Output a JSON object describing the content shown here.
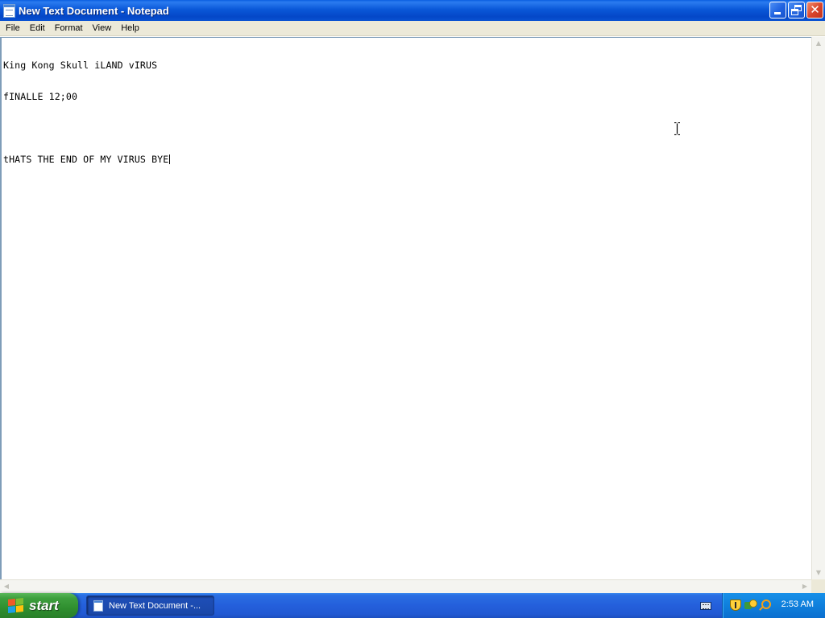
{
  "window": {
    "title": "New Text Document - Notepad",
    "app_icon": "notepad-icon",
    "controls": {
      "minimize_icon": "minimize-icon",
      "restore_icon": "restore-icon",
      "close_icon": "close-icon",
      "close_glyph": "✕"
    }
  },
  "menu": {
    "items": [
      {
        "label": "File"
      },
      {
        "label": "Edit"
      },
      {
        "label": "Format"
      },
      {
        "label": "View"
      },
      {
        "label": "Help"
      }
    ]
  },
  "editor": {
    "lines": [
      "King Kong Skull iLAND vIRUS",
      "fINALLE 12;00",
      "",
      "tHATS THE END OF MY VIRUS BYE"
    ]
  },
  "scrollbars": {
    "up_arrow": "▲",
    "down_arrow": "▼",
    "left_arrow": "◀",
    "right_arrow": "▶"
  },
  "taskbar": {
    "start_label": "start",
    "task_button_label": "New Text Document -...",
    "clock": "2:53 AM",
    "tray_icons": [
      "keyboard-icon",
      "security-shield-icon",
      "network-icon",
      "search-icon"
    ]
  },
  "colors": {
    "titlebar": "#0a58d8",
    "taskbar": "#245fdb",
    "start_button": "#3ea03e",
    "close_button": "#d8432a",
    "menubar": "#ece9d8"
  }
}
